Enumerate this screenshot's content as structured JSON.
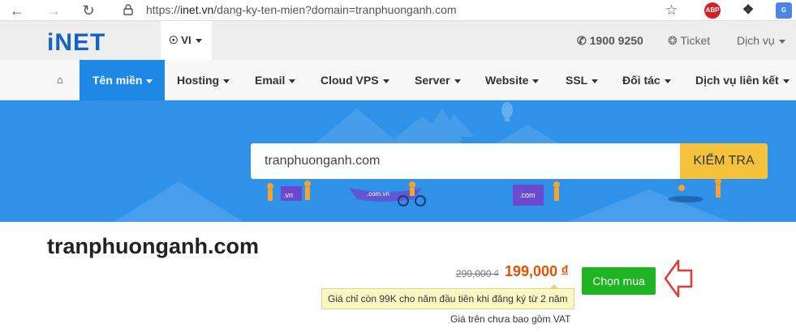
{
  "browser": {
    "url_prefix": "https://",
    "url_host": "inet.vn",
    "url_path": "/dang-ky-ten-mien?domain=tranphuonganh.com",
    "ext_abp": "ABP"
  },
  "topbar": {
    "logo": "iNET",
    "lang": "VI",
    "phone": "1900 9250",
    "ticket": "Ticket",
    "service": "Dịch vụ"
  },
  "menu": {
    "items": [
      "Tên miền",
      "Hosting",
      "Email",
      "Cloud VPS",
      "Server",
      "Website",
      "SSL",
      "Đối tác",
      "Dịch vụ liên kết"
    ]
  },
  "hero": {
    "search_value": "tranphuonganh.com",
    "search_button": "KIỂM TRA",
    "badge_vn": ".vn",
    "badge_comvn": ".com.vn",
    "badge_com": ".com"
  },
  "result": {
    "domain": "tranphuonganh.com",
    "old_price": "299,000 ₫",
    "new_price": "199,000",
    "currency": "đ",
    "buy_label": "Chọn mua",
    "promo": "Giá chỉ còn 99K cho năm đầu tiên khi đăng ký từ 2 năm",
    "vat_note": "Giá trên chưa bao gồm VAT"
  },
  "colors": {
    "brand_blue": "#1e88e5",
    "hero_blue": "#2f91e8",
    "check_yellow": "#f5c33a",
    "buy_green": "#1fb522",
    "price_orange": "#e65100",
    "arrow_red": "#e53935"
  }
}
